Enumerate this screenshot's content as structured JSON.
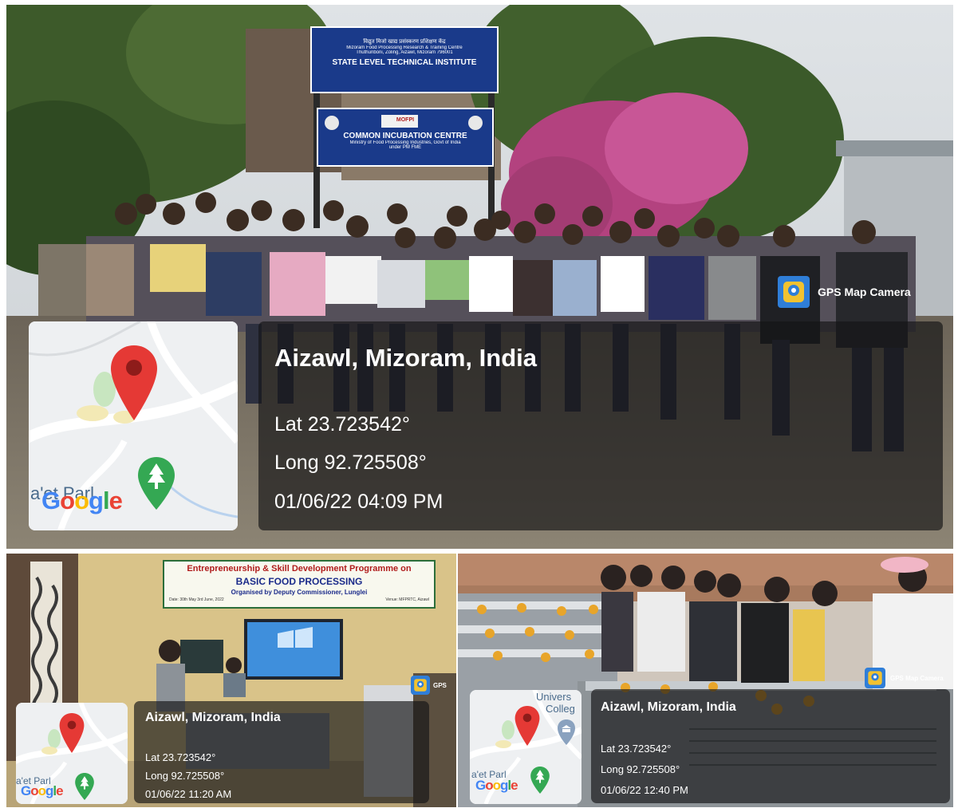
{
  "main": {
    "signs": {
      "top_small": "विद्युत मिजो खाद्य प्रसंस्करण प्रशिक्षण केंद्र",
      "top_line1": "Mizoram Food Processing Research & Training Centre",
      "top_line2": "Thuthunboni, Zoling, Aizawl, Mizoram 796001",
      "top_title": "STATE LEVEL TECHNICAL INSTITUTE",
      "bottom_logo": "MOFPI",
      "bottom_title": "COMMON INCUBATION CENTRE",
      "bottom_sub1": "Ministry of Food Processing Industries, Govt of India",
      "bottom_sub2": "under PM FME"
    },
    "gps_label": "GPS Map Camera",
    "place": "Aizawl, Mizoram, India",
    "lat": "Lat 23.723542°",
    "long": "Long 92.725508°",
    "datetime": "01/06/22 04:09 PM",
    "map_partial": "a'et Parl",
    "google": [
      "G",
      "o",
      "o",
      "g",
      "l",
      "e"
    ]
  },
  "left": {
    "banner": {
      "line1": "Entrepreneurship & Skill Development Programme on",
      "line2": "BASIC FOOD PROCESSING",
      "line3": "Organised by Deputy Commissioner, Lunglei",
      "date_left": "Date: 30th May 3rd June, 2022",
      "date_right": "Venue: MFPRTC, Aizawl"
    },
    "gps_label": "GPS",
    "place": "Aizawl, Mizoram, India",
    "lat": "Lat 23.723542°",
    "long": "Long 92.725508°",
    "datetime": "01/06/22 11:20 AM",
    "map_partial": "a'et Parl",
    "google": [
      "G",
      "o",
      "o",
      "g",
      "l",
      "e"
    ]
  },
  "right": {
    "gps_label": "GPS Map Camera",
    "place": "Aizawl, Mizoram, India",
    "lat": "Lat 23.723542°",
    "long": "Long 92.725508°",
    "datetime": "01/06/22 12:40 PM",
    "map_partial": "a'et Parl",
    "map_label_top": "Univers",
    "map_label_college": "Colleg",
    "google": [
      "G",
      "o",
      "o",
      "g",
      "l",
      "e"
    ]
  },
  "colors": {
    "google": [
      "#4285F4",
      "#EA4335",
      "#FBBC05",
      "#4285F4",
      "#34A853",
      "#EA4335"
    ],
    "pin": "#e53935",
    "tree": "#34a853",
    "sign_blue": "#1a3a8a"
  },
  "icons": [
    "location-pin-icon",
    "tree-icon",
    "gps-camera-icon",
    "university-icon"
  ]
}
